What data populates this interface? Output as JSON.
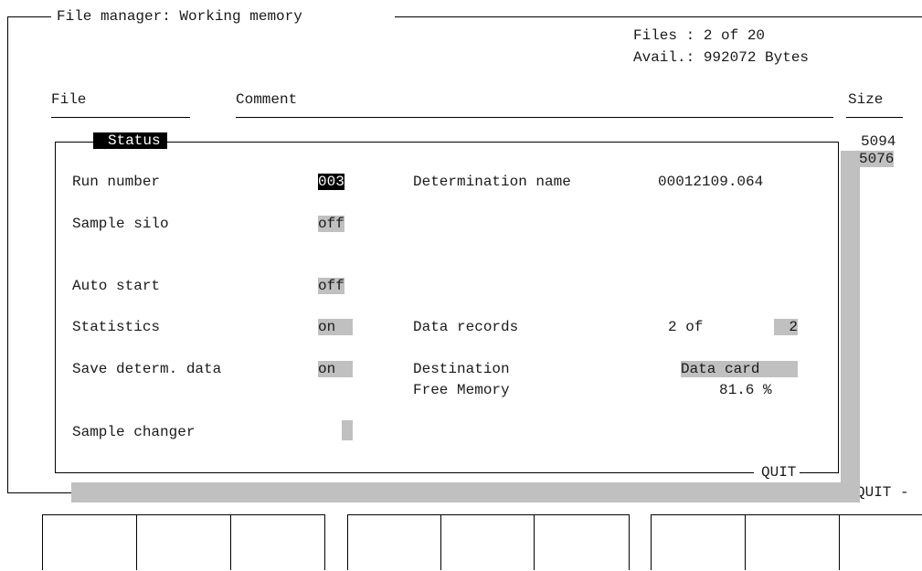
{
  "window": {
    "title": "File manager: Working memory",
    "quit_label": "QUIT"
  },
  "info": {
    "files": "Files : 2 of 20",
    "avail": "Avail.: 992072 Bytes"
  },
  "columns": {
    "file": "File",
    "comment": "Comment",
    "size": "Size"
  },
  "file_sizes": [
    "5094",
    "5076"
  ],
  "dialog": {
    "title": "Status",
    "quit_label": "QUIT",
    "run_number_label": "Run number",
    "run_number_value": "003",
    "determination_name_label": "Determination name",
    "determination_name_value": "00012109.064",
    "sample_silo_label": "Sample silo",
    "sample_silo_value": "off",
    "auto_start_label": "Auto start",
    "auto_start_value": "off",
    "statistics_label": "Statistics",
    "statistics_value": "on",
    "data_records_label": "Data records",
    "data_records_of": "2 of",
    "data_records_value": "2",
    "save_determ_label": "Save determ. data",
    "save_determ_value": "on",
    "destination_label": "Destination",
    "destination_value": "Data card",
    "free_memory_label": "Free Memory",
    "free_memory_value": "81.6 %",
    "sample_changer_label": "Sample changer",
    "sample_changer_value": ""
  }
}
